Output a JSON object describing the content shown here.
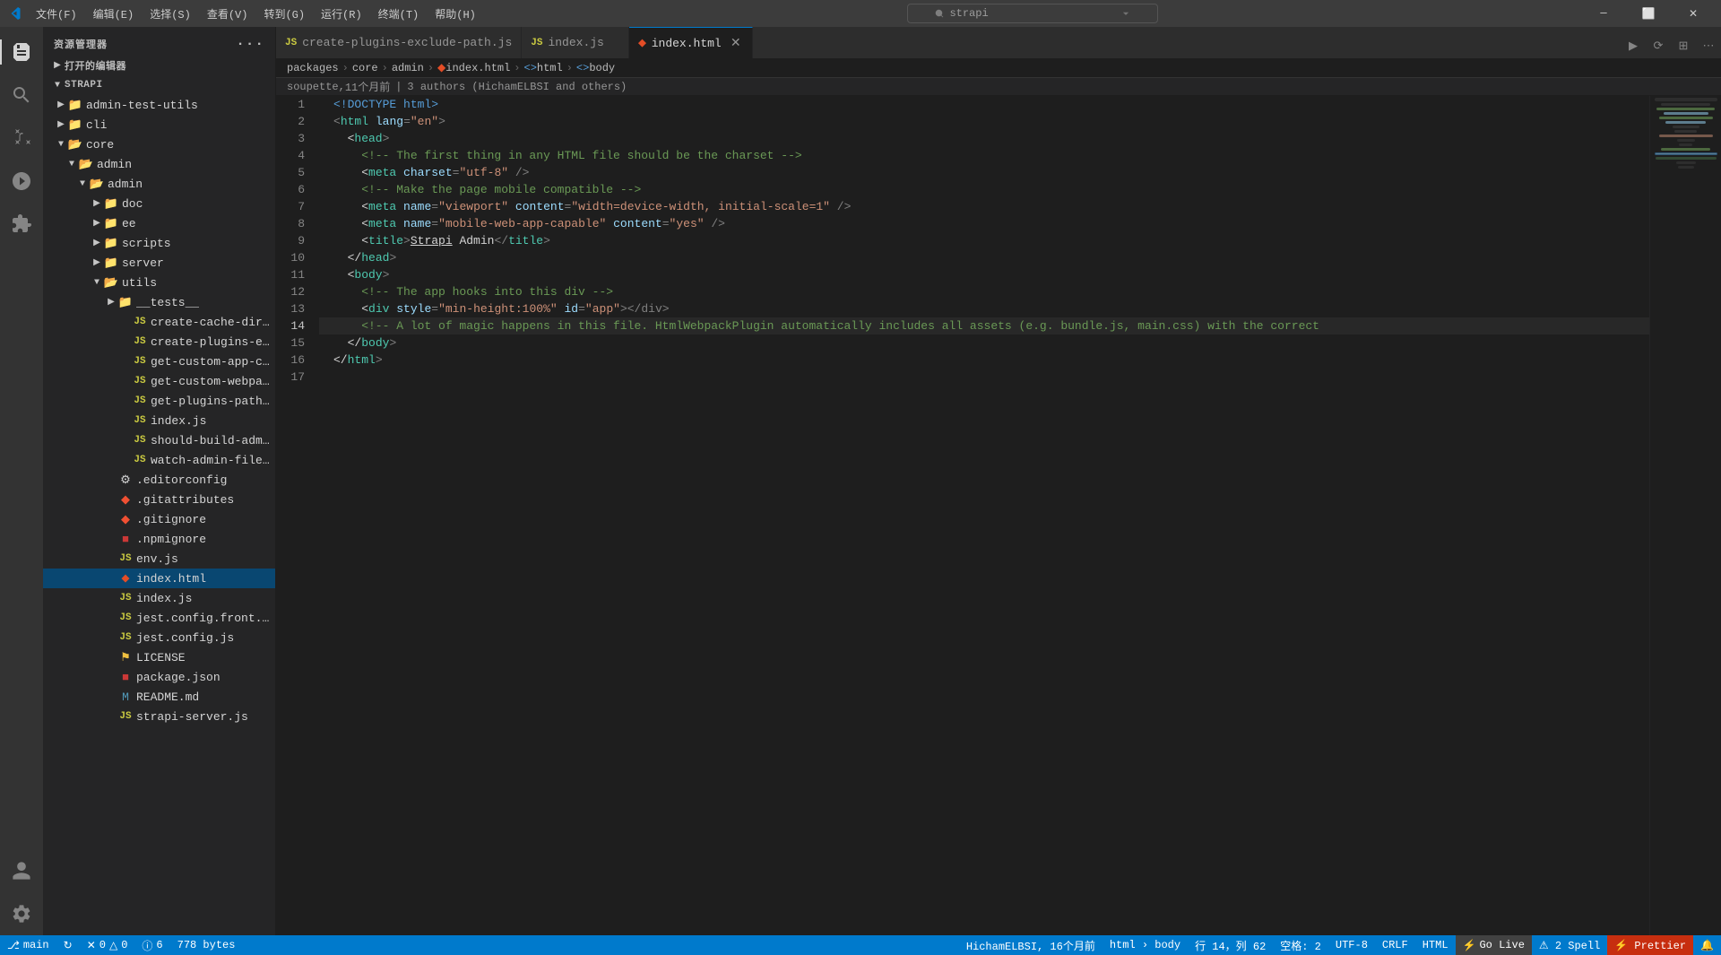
{
  "titlebar": {
    "icon": "vscode-icon",
    "menus": [
      "文件(F)",
      "编辑(E)",
      "选择(S)",
      "查看(V)",
      "转到(G)",
      "运行(R)",
      "终端(T)",
      "帮助(H)"
    ],
    "search_placeholder": "strapi",
    "buttons": [
      "minimize",
      "maximize-restore",
      "close"
    ]
  },
  "activity_bar": {
    "icons": [
      {
        "name": "explorer-icon",
        "label": "Explorer",
        "active": true
      },
      {
        "name": "search-icon",
        "label": "Search"
      },
      {
        "name": "source-control-icon",
        "label": "Source Control"
      },
      {
        "name": "run-icon",
        "label": "Run"
      },
      {
        "name": "extensions-icon",
        "label": "Extensions"
      },
      {
        "name": "account-icon",
        "label": "Account"
      },
      {
        "name": "settings-icon",
        "label": "Settings"
      }
    ]
  },
  "sidebar": {
    "title": "资源管理器",
    "more_label": "···",
    "open_editors_label": "打开的编辑器",
    "root_label": "STRAPI",
    "tree": [
      {
        "level": 1,
        "type": "folder",
        "name": "admin-test-utils",
        "open": false,
        "indent": 12
      },
      {
        "level": 1,
        "type": "folder",
        "name": "cli",
        "open": false,
        "indent": 12
      },
      {
        "level": 1,
        "type": "folder",
        "name": "core",
        "open": true,
        "indent": 12
      },
      {
        "level": 2,
        "type": "folder",
        "name": "admin",
        "open": true,
        "indent": 24
      },
      {
        "level": 3,
        "type": "folder",
        "name": "admin",
        "open": true,
        "indent": 36
      },
      {
        "level": 4,
        "type": "folder",
        "name": "doc",
        "open": false,
        "indent": 52
      },
      {
        "level": 4,
        "type": "folder",
        "name": "ee",
        "open": false,
        "indent": 52
      },
      {
        "level": 4,
        "type": "folder",
        "name": "scripts",
        "open": false,
        "indent": 52
      },
      {
        "level": 4,
        "type": "folder",
        "name": "server",
        "open": false,
        "indent": 52
      },
      {
        "level": 4,
        "type": "folder",
        "name": "utils",
        "open": true,
        "indent": 52
      },
      {
        "level": 5,
        "type": "folder",
        "name": "__tests__",
        "open": false,
        "indent": 68
      },
      {
        "level": 5,
        "type": "js",
        "name": "create-cache-dir.js",
        "indent": 68
      },
      {
        "level": 5,
        "type": "js",
        "name": "create-plugins-exclud...",
        "indent": 68
      },
      {
        "level": 5,
        "type": "js",
        "name": "get-custom-app-conf...",
        "indent": 68
      },
      {
        "level": 5,
        "type": "js",
        "name": "get-custom-webpack...",
        "indent": 68
      },
      {
        "level": 5,
        "type": "js",
        "name": "get-plugins-path.js",
        "indent": 68
      },
      {
        "level": 5,
        "type": "js",
        "name": "index.js",
        "indent": 68
      },
      {
        "level": 5,
        "type": "js",
        "name": "should-build-admin.js",
        "indent": 68
      },
      {
        "level": 5,
        "type": "js",
        "name": "watch-admin-files.js",
        "indent": 68
      },
      {
        "level": 4,
        "type": "editorconfig",
        "name": ".editorconfig",
        "indent": 52
      },
      {
        "level": 4,
        "type": "gitattributes",
        "name": ".gitattributes",
        "indent": 52
      },
      {
        "level": 4,
        "type": "gitignore",
        "name": ".gitignore",
        "indent": 52
      },
      {
        "level": 4,
        "type": "npmignore",
        "name": ".npmignore",
        "indent": 52
      },
      {
        "level": 4,
        "type": "js",
        "name": "env.js",
        "indent": 52
      },
      {
        "level": 4,
        "type": "html",
        "name": "index.html",
        "indent": 52,
        "selected": true
      },
      {
        "level": 4,
        "type": "js",
        "name": "index.js",
        "indent": 52
      },
      {
        "level": 4,
        "type": "js",
        "name": "jest.config.front.js",
        "indent": 52
      },
      {
        "level": 4,
        "type": "json",
        "name": "jest.config.js",
        "indent": 52
      },
      {
        "level": 4,
        "type": "license",
        "name": "LICENSE",
        "indent": 52
      },
      {
        "level": 4,
        "type": "json",
        "name": "package.json",
        "indent": 52
      },
      {
        "level": 4,
        "type": "md",
        "name": "README.md",
        "indent": 52
      },
      {
        "level": 4,
        "type": "js",
        "name": "strapi-server.js",
        "indent": 52
      }
    ]
  },
  "tabs": [
    {
      "icon": "js",
      "name": "create-plugins-exclude-path.js",
      "active": false,
      "closable": false
    },
    {
      "icon": "js",
      "name": "index.js",
      "active": false,
      "closable": false
    },
    {
      "icon": "html",
      "name": "index.html",
      "active": true,
      "closable": true
    }
  ],
  "breadcrumb": {
    "items": [
      "packages",
      "core",
      "admin",
      "index.html",
      "html",
      "body"
    ]
  },
  "git_info": {
    "author": "soupette",
    "time": "11个月前",
    "contributors": "3 authors (HichamELBSI and others)"
  },
  "code": {
    "lines": [
      {
        "num": 1,
        "content": "<!DOCTYPE html>",
        "tokens": [
          {
            "text": "<!DOCTYPE html>",
            "class": "c-doctype"
          }
        ]
      },
      {
        "num": 2,
        "content": "<html lang=\"en\">",
        "tokens": [
          {
            "text": "<",
            "class": "c-punct"
          },
          {
            "text": "html",
            "class": "c-tag"
          },
          {
            "text": " ",
            "class": "c-text"
          },
          {
            "text": "lang",
            "class": "c-attr"
          },
          {
            "text": "=",
            "class": "c-punct"
          },
          {
            "text": "\"en\"",
            "class": "c-val"
          },
          {
            "text": ">",
            "class": "c-punct"
          }
        ]
      },
      {
        "num": 3,
        "content": "  <head>",
        "tokens": [
          {
            "text": "  <",
            "class": "c-text"
          },
          {
            "text": "head",
            "class": "c-tag"
          },
          {
            "text": ">",
            "class": "c-punct"
          }
        ]
      },
      {
        "num": 4,
        "content": "    <!-- The first thing in any HTML file should be the charset -->",
        "tokens": [
          {
            "text": "    <!-- The first thing in any HTML file should be the charset -->",
            "class": "c-comment"
          }
        ]
      },
      {
        "num": 5,
        "content": "    <meta charset=\"utf-8\" />",
        "tokens": [
          {
            "text": "    <",
            "class": "c-text"
          },
          {
            "text": "meta",
            "class": "c-tag"
          },
          {
            "text": " ",
            "class": "c-text"
          },
          {
            "text": "charset",
            "class": "c-attr"
          },
          {
            "text": "=",
            "class": "c-punct"
          },
          {
            "text": "\"utf-8\"",
            "class": "c-val"
          },
          {
            "text": " />",
            "class": "c-punct"
          }
        ]
      },
      {
        "num": 6,
        "content": "    <!-- Make the page mobile compatible -->",
        "tokens": [
          {
            "text": "    <!-- Make the page mobile compatible -->",
            "class": "c-comment"
          }
        ]
      },
      {
        "num": 7,
        "content": "    <meta name=\"viewport\" content=\"width=device-width, initial-scale=1\" />",
        "tokens": [
          {
            "text": "    <",
            "class": "c-text"
          },
          {
            "text": "meta",
            "class": "c-tag"
          },
          {
            "text": " ",
            "class": "c-text"
          },
          {
            "text": "name",
            "class": "c-attr"
          },
          {
            "text": "=",
            "class": "c-punct"
          },
          {
            "text": "\"viewport\"",
            "class": "c-val"
          },
          {
            "text": " ",
            "class": "c-text"
          },
          {
            "text": "content",
            "class": "c-attr"
          },
          {
            "text": "=",
            "class": "c-punct"
          },
          {
            "text": "\"width=device-width, initial-scale=1\"",
            "class": "c-val"
          },
          {
            "text": " />",
            "class": "c-punct"
          }
        ]
      },
      {
        "num": 8,
        "content": "    <meta name=\"mobile-web-app-capable\" content=\"yes\" />",
        "tokens": [
          {
            "text": "    <",
            "class": "c-text"
          },
          {
            "text": "meta",
            "class": "c-tag"
          },
          {
            "text": " ",
            "class": "c-text"
          },
          {
            "text": "name",
            "class": "c-attr"
          },
          {
            "text": "=",
            "class": "c-punct"
          },
          {
            "text": "\"mobile-web-app-capable\"",
            "class": "c-val"
          },
          {
            "text": " ",
            "class": "c-text"
          },
          {
            "text": "content",
            "class": "c-attr"
          },
          {
            "text": "=",
            "class": "c-punct"
          },
          {
            "text": "\"yes\"",
            "class": "c-val"
          },
          {
            "text": " />",
            "class": "c-punct"
          }
        ]
      },
      {
        "num": 9,
        "content": "    <title>Strapi Admin</title>",
        "tokens": [
          {
            "text": "    <",
            "class": "c-text"
          },
          {
            "text": "title",
            "class": "c-tag"
          },
          {
            "text": ">",
            "class": "c-punct"
          },
          {
            "text": "Strapi Admin",
            "class": "c-text"
          },
          {
            "text": "</",
            "class": "c-punct"
          },
          {
            "text": "title",
            "class": "c-tag"
          },
          {
            "text": ">",
            "class": "c-punct"
          }
        ]
      },
      {
        "num": 10,
        "content": "  </head>",
        "tokens": [
          {
            "text": "  </",
            "class": "c-text"
          },
          {
            "text": "head",
            "class": "c-tag"
          },
          {
            "text": ">",
            "class": "c-punct"
          }
        ]
      },
      {
        "num": 11,
        "content": "  <body>",
        "tokens": [
          {
            "text": "  <",
            "class": "c-text"
          },
          {
            "text": "body",
            "class": "c-tag"
          },
          {
            "text": ">",
            "class": "c-punct"
          }
        ]
      },
      {
        "num": 12,
        "content": "    <!-- The app hooks into this div -->",
        "tokens": [
          {
            "text": "    <!-- The app hooks into this div -->",
            "class": "c-comment"
          }
        ]
      },
      {
        "num": 13,
        "content": "    <div style=\"min-height:100%\" id=\"app\"></div>",
        "tokens": [
          {
            "text": "    <",
            "class": "c-text"
          },
          {
            "text": "div",
            "class": "c-tag"
          },
          {
            "text": " ",
            "class": "c-text"
          },
          {
            "text": "style",
            "class": "c-attr"
          },
          {
            "text": "=",
            "class": "c-punct"
          },
          {
            "text": "\"min-height:100%\"",
            "class": "c-val"
          },
          {
            "text": " ",
            "class": "c-text"
          },
          {
            "text": "id",
            "class": "c-attr"
          },
          {
            "text": "=",
            "class": "c-punct"
          },
          {
            "text": "\"app\"",
            "class": "c-val"
          },
          {
            "text": "></div>",
            "class": "c-punct"
          }
        ]
      },
      {
        "num": 14,
        "content": "    <!-- A lot of magic happens in this file. HtmlWebpackPlugin automatically includes all assets (e.g. bundle.js, main.css) with the correct",
        "tokens": [
          {
            "text": "    <!-- A lot of magic happens in this file. HtmlWebpackPlugin automatically includes all assets (e.g. bundle.js, main.css) with the correct",
            "class": "c-comment"
          }
        ]
      },
      {
        "num": 15,
        "content": "  </body>",
        "tokens": [
          {
            "text": "  </",
            "class": "c-text"
          },
          {
            "text": "body",
            "class": "c-tag"
          },
          {
            "text": ">",
            "class": "c-punct"
          }
        ]
      },
      {
        "num": 16,
        "content": "</html>",
        "tokens": [
          {
            "text": "</",
            "class": "c-text"
          },
          {
            "text": "html",
            "class": "c-tag"
          },
          {
            "text": ">",
            "class": "c-punct"
          }
        ]
      },
      {
        "num": 17,
        "content": "",
        "tokens": []
      }
    ],
    "active_line": 14,
    "cursor": {
      "line": 14,
      "col": 62
    }
  },
  "status_bar": {
    "left": [
      {
        "icon": "branch-icon",
        "text": "main",
        "name": "git-branch"
      },
      {
        "icon": "sync-icon",
        "text": "",
        "name": "sync"
      },
      {
        "icon": "error-icon",
        "text": "0",
        "name": "errors"
      },
      {
        "icon": "warning-icon",
        "text": "0",
        "name": "warnings"
      },
      {
        "icon": "info-icon",
        "text": "6",
        "name": "infos"
      },
      {
        "text": "778 bytes",
        "name": "file-size"
      }
    ],
    "right": [
      {
        "text": "HichamELBSI, 16个月前",
        "name": "git-blame"
      },
      {
        "text": "html › body",
        "name": "symbol"
      },
      {
        "text": "行 14，列 62",
        "name": "cursor-position"
      },
      {
        "text": "空格: 2",
        "name": "spaces"
      },
      {
        "text": "UTF-8",
        "name": "encoding"
      },
      {
        "text": "CRLF",
        "name": "line-ending"
      },
      {
        "text": "HTML",
        "name": "language"
      },
      {
        "text": "Go Live",
        "name": "go-live"
      },
      {
        "text": "⚠ 2 Spell",
        "name": "spell-check"
      },
      {
        "text": "⚡ Prettier",
        "name": "prettier"
      },
      {
        "icon": "notifications-icon",
        "text": "",
        "name": "notifications"
      }
    ]
  }
}
